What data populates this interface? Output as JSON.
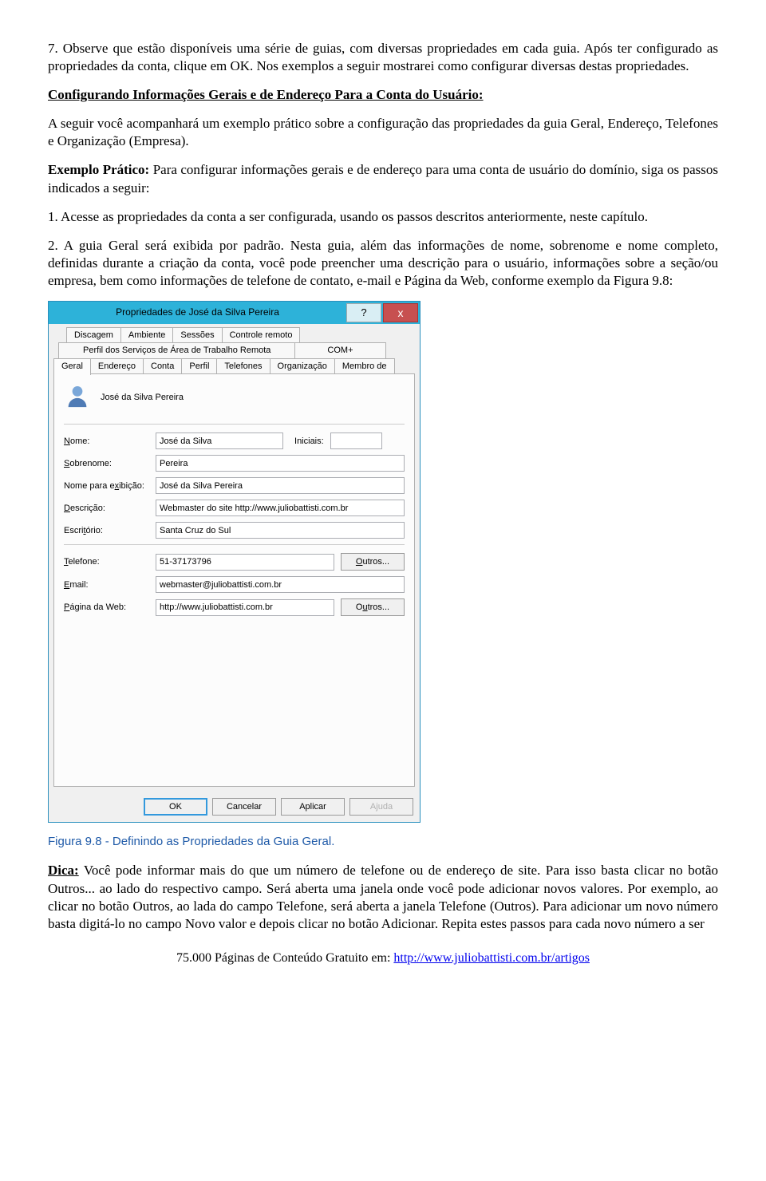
{
  "body": {
    "p1": "7.        Observe que estão disponíveis uma série de guias, com diversas propriedades em cada guia. Após ter configurado as propriedades da conta, clique em OK. Nos exemplos a seguir mostrarei como configurar diversas destas propriedades.",
    "section_title": " Configurando Informações Gerais e de Endereço Para a Conta do Usuário:",
    "p2": "A seguir você acompanhará um exemplo prático sobre a configuração das propriedades da guia Geral, Endereço, Telefones e Organização (Empresa).",
    "p3_bold": "Exemplo Prático: ",
    "p3_rest": "Para configurar informações gerais e de endereço para uma conta de usuário do domínio, siga os passos indicados a seguir:",
    "p4": "1.        Acesse as propriedades da conta a ser configurada, usando os passos descritos anteriormente, neste capítulo.",
    "p5": "2.        A guia Geral será exibida por padrão. Nesta guia, além das informações de nome, sobrenome e nome completo, definidas durante a criação da conta, você pode preencher uma descrição para o usuário, informações sobre a seção/ou empresa, bem como informações de telefone de contato, e-mail e Página da Web, conforme exemplo da Figura 9.8:",
    "caption": "Figura 9.8 - Definindo as Propriedades da Guia Geral.",
    "dica_label": "Dica:",
    "dica_text": " Você pode informar mais do que um número de telefone ou de endereço de site. Para isso basta clicar no botão Outros... ao lado do respectivo campo. Será aberta uma janela onde você pode adicionar novos valores. Por exemplo, ao clicar no botão Outros, ao lada do campo Telefone, será aberta a janela Telefone (Outros). Para adicionar um novo número basta digitá-lo no campo Novo valor e depois clicar no botão Adicionar. Repita estes passos para cada novo número a ser",
    "footer_prefix": "75.000 Páginas de Conteúdo Gratuito em: ",
    "footer_link": "http://www.juliobattisti.com.br/artigos"
  },
  "dialog": {
    "title": "Propriedades de José da Silva Pereira",
    "help_btn": "?",
    "close_btn": "x",
    "tabs_row1": [
      "Discagem",
      "Ambiente",
      "Sessões",
      "Controle remoto"
    ],
    "tabs_row2": [
      "Perfil dos Serviços de Área de Trabalho Remota",
      "COM+"
    ],
    "tabs_row3": [
      "Geral",
      "Endereço",
      "Conta",
      "Perfil",
      "Telefones",
      "Organização",
      "Membro de"
    ],
    "user_display": "José da Silva Pereira",
    "labels": {
      "nome": "Nome:",
      "iniciais": "Iniciais:",
      "sobrenome": "Sobrenome:",
      "nome_exib": "Nome para exibição:",
      "descricao": "Descrição:",
      "escritorio": "Escritório:",
      "telefone": "Telefone:",
      "email": "Email:",
      "pagina": "Página da Web:"
    },
    "values": {
      "nome": "José da Silva",
      "iniciais": "",
      "sobrenome": "Pereira",
      "nome_exib": "José da Silva Pereira",
      "descricao": "Webmaster do site http://www.juliobattisti.com.br",
      "escritorio": "Santa Cruz do Sul",
      "telefone": "51-37173796",
      "email": "webmaster@juliobattisti.com.br",
      "pagina": "http://www.juliobattisti.com.br"
    },
    "outros_label": "Outros...",
    "buttons": {
      "ok": "OK",
      "cancelar": "Cancelar",
      "aplicar": "Aplicar",
      "ajuda": "Ajuda"
    }
  }
}
